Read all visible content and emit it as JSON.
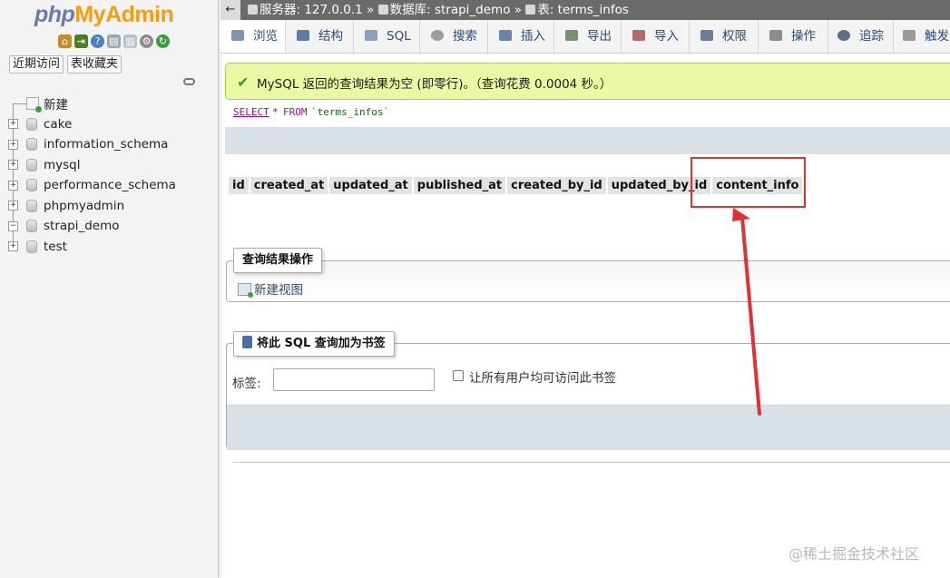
{
  "nav": {
    "logo": {
      "php": "php",
      "my": "My",
      "admin": "Admin"
    },
    "icons": [
      "home-icon",
      "exit-icon",
      "help-icon",
      "docs-icon",
      "sql-docs-icon",
      "settings-icon",
      "reload-icon"
    ],
    "tabs": [
      "近期访问",
      "表收藏夹"
    ],
    "tree": [
      {
        "label": "新建",
        "type": "new"
      },
      {
        "label": "cake",
        "expander": "+"
      },
      {
        "label": "information_schema",
        "expander": "+"
      },
      {
        "label": "mysql",
        "expander": "+"
      },
      {
        "label": "performance_schema",
        "expander": "+"
      },
      {
        "label": "phpmyadmin",
        "expander": "+"
      },
      {
        "label": "strapi_demo",
        "expander": "−"
      },
      {
        "label": "test",
        "expander": "+"
      }
    ]
  },
  "breadcrumb": {
    "back": "←",
    "server": "服务器: 127.0.0.1",
    "sep": "»",
    "database": "数据库: strapi_demo",
    "table": "表: terms_infos"
  },
  "tabs": [
    {
      "label": "浏览",
      "icon": "browse-icon",
      "active": true
    },
    {
      "label": "结构",
      "icon": "structure-icon"
    },
    {
      "label": "SQL",
      "icon": "sql-icon"
    },
    {
      "label": "搜索",
      "icon": "search-icon"
    },
    {
      "label": "插入",
      "icon": "insert-icon"
    },
    {
      "label": "导出",
      "icon": "export-icon"
    },
    {
      "label": "导入",
      "icon": "import-icon"
    },
    {
      "label": "权限",
      "icon": "privileges-icon"
    },
    {
      "label": "操作",
      "icon": "operations-icon"
    },
    {
      "label": "追踪",
      "icon": "tracking-icon"
    },
    {
      "label": "触发",
      "icon": "triggers-icon"
    }
  ],
  "success_message": "MySQL 返回的查询结果为空 (即零行)。（查询花费 0.0004 秒。）",
  "sql": {
    "select": "SELECT",
    "star": "*",
    "from": "FROM",
    "table": "`terms_infos`"
  },
  "columns": [
    "id",
    "created_at",
    "updated_at",
    "published_at",
    "created_by_id",
    "updated_by_id",
    "content_info"
  ],
  "query_ops": {
    "legend": "查询结果操作",
    "new_view": "新建视图"
  },
  "bookmark": {
    "legend": "将此 SQL 查询加为书签",
    "label": "标签:",
    "input_value": "",
    "checkbox_label": "让所有用户均可访问此书签"
  },
  "colors": {
    "highlight": "#e03232",
    "success_bg": "#ebf8a4",
    "accent": "#f89c0e"
  },
  "watermark": "@稀土掘金技术社区"
}
